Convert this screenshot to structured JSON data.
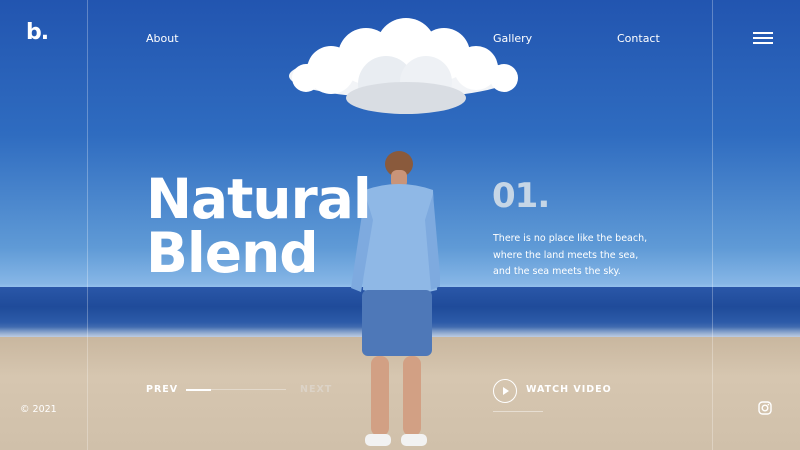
{
  "brand": {
    "logo": "b."
  },
  "nav": {
    "about": "About",
    "gallery": "Gallery",
    "contact": "Contact"
  },
  "icons": {
    "menu": "menu-icon",
    "play": "play-icon",
    "social": "instagram-icon"
  },
  "hero": {
    "title_line1": "Natural",
    "title_line2": "Blend",
    "number": "01.",
    "description_lines": [
      "There is no place like the beach,",
      "where the land meets the sea,",
      "and the sea meets the sky."
    ]
  },
  "slider": {
    "prev": "PREV",
    "next": "NEXT",
    "progress": 0.25
  },
  "video": {
    "label": "WATCH VIDEO"
  },
  "footer": {
    "copyright": "© 2021"
  },
  "colors": {
    "accent": "#ffffff",
    "sky": "#2f6cc0",
    "sand": "#d6c6b0",
    "number": "#c6d6e6"
  }
}
